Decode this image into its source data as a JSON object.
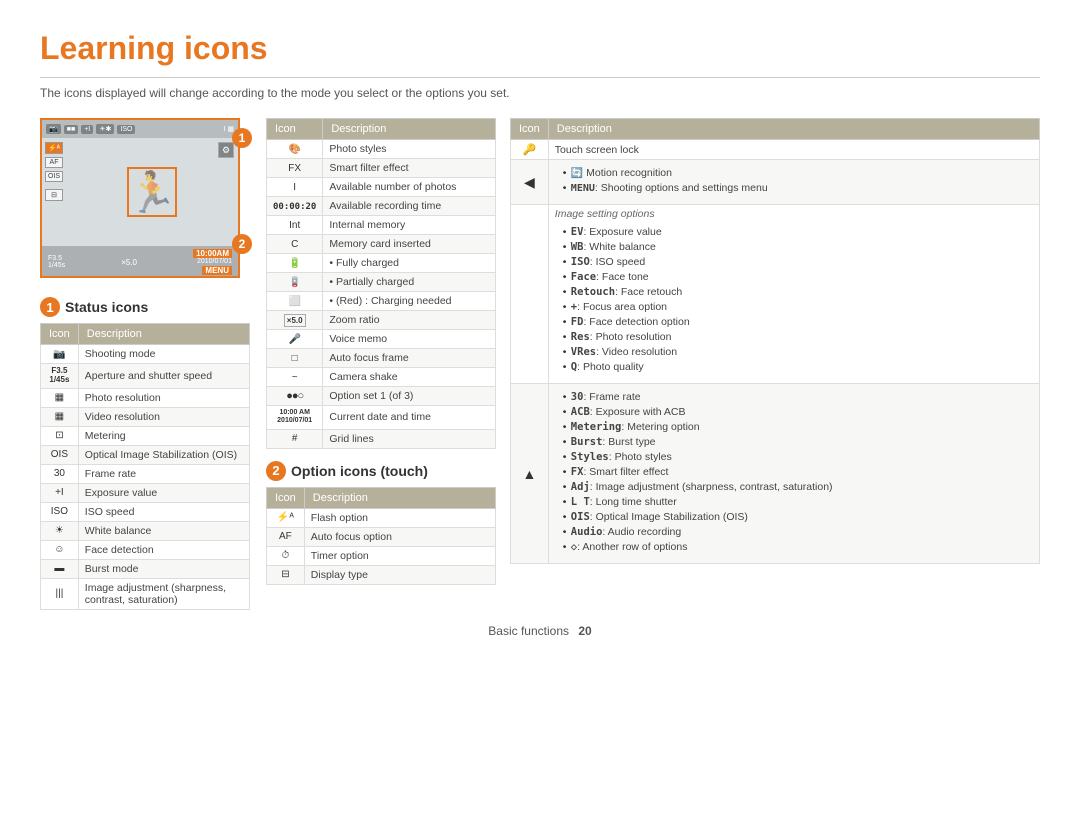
{
  "page": {
    "title": "Learning icons",
    "subtitle": "The icons displayed will change according to the mode you select or the options you set."
  },
  "status_section": {
    "label": "Status icons",
    "number": "1",
    "table_headers": [
      "Icon",
      "Description"
    ],
    "rows": [
      {
        "icon": "📷",
        "desc": "Shooting mode"
      },
      {
        "icon": "F3.5\n1/45s",
        "desc": "Aperture and shutter speed"
      },
      {
        "icon": "▦",
        "desc": "Photo resolution"
      },
      {
        "icon": "▦",
        "desc": "Video resolution"
      },
      {
        "icon": "⊡",
        "desc": "Metering"
      },
      {
        "icon": "OIS",
        "desc": "Optical Image Stabilization (OIS)"
      },
      {
        "icon": "30",
        "desc": "Frame rate"
      },
      {
        "icon": "+I",
        "desc": "Exposure value"
      },
      {
        "icon": "ISO",
        "desc": "ISO speed"
      },
      {
        "icon": "☀",
        "desc": "White balance"
      },
      {
        "icon": "☺",
        "desc": "Face detection"
      },
      {
        "icon": "▬",
        "desc": "Burst mode"
      },
      {
        "icon": "|||",
        "desc": "Image adjustment (sharpness, contrast, saturation)"
      }
    ]
  },
  "mid_section": {
    "table_headers": [
      "Icon",
      "Description"
    ],
    "rows": [
      {
        "icon": "🎨",
        "desc": "Photo styles"
      },
      {
        "icon": "FX",
        "desc": "Smart filter effect"
      },
      {
        "icon": "I",
        "desc": "Available number of photos"
      },
      {
        "icon": "00:00:20",
        "desc": "Available recording time"
      },
      {
        "icon": "Int",
        "desc": "Internal memory"
      },
      {
        "icon": "C",
        "desc": "Memory card inserted"
      },
      {
        "icon": "battery_full",
        "desc": "Fully charged",
        "bullet": true
      },
      {
        "icon": "battery_mid",
        "desc": "Partially charged",
        "bullet": true
      },
      {
        "icon": "battery_low",
        "desc": "(Red) : Charging needed",
        "bullet": true
      },
      {
        "icon": "×5.0",
        "desc": "Zoom ratio"
      },
      {
        "icon": "🎤",
        "desc": "Voice memo"
      },
      {
        "icon": "□",
        "desc": "Auto focus frame"
      },
      {
        "icon": "~",
        "desc": "Camera shake"
      },
      {
        "icon": "●●○",
        "desc": "Option set 1 (of 3)"
      },
      {
        "icon": "10:00AM\n2010/07/01",
        "desc": "Current date and time"
      },
      {
        "icon": "#",
        "desc": "Grid lines"
      }
    ]
  },
  "option_section": {
    "label": "Option icons (touch)",
    "number": "2",
    "table_headers": [
      "Icon",
      "Description"
    ],
    "rows": [
      {
        "icon": "⚡ᴬ",
        "desc": "Flash option"
      },
      {
        "icon": "AF",
        "desc": "Auto focus option"
      },
      {
        "icon": "⏱",
        "desc": "Timer option"
      },
      {
        "icon": "⊟",
        "desc": "Display type"
      }
    ]
  },
  "right_section": {
    "table_headers": [
      "Icon",
      "Description"
    ],
    "rows_top": [
      {
        "icon": "🔑",
        "desc": "Touch screen lock"
      }
    ],
    "bullet_group_1": {
      "icon": "◀",
      "items": [
        "Motion recognition",
        "MENU : Shooting options and settings menu"
      ]
    },
    "image_setting_label": "Image setting options",
    "bullet_group_2": {
      "items": [
        "EV : Exposure value",
        "WB : White balance",
        "ISO : ISO speed",
        "Face : Face tone",
        "Retouch : Face retouch",
        "+ : Focus area option",
        "FD : Face detection option",
        "Res : Photo resolution",
        "VRes : Video resolution",
        "Q : Photo quality"
      ]
    },
    "bullet_group_3": {
      "icon": "▲",
      "items": [
        "30 : Frame rate",
        "ACB : Exposure with ACB",
        "Metering : Metering option",
        "Burst : Burst type",
        "Styles : Photo styles",
        "FX : Smart filter effect",
        "Adj : Image adjustment (sharpness, contrast, saturation)",
        "LT : Long time shutter",
        "OIS : Optical Image Stabilization (OIS)",
        "Audio : Audio recording",
        "◇ : Another row of options"
      ]
    }
  },
  "footer": {
    "label": "Basic functions",
    "page_num": "20"
  }
}
